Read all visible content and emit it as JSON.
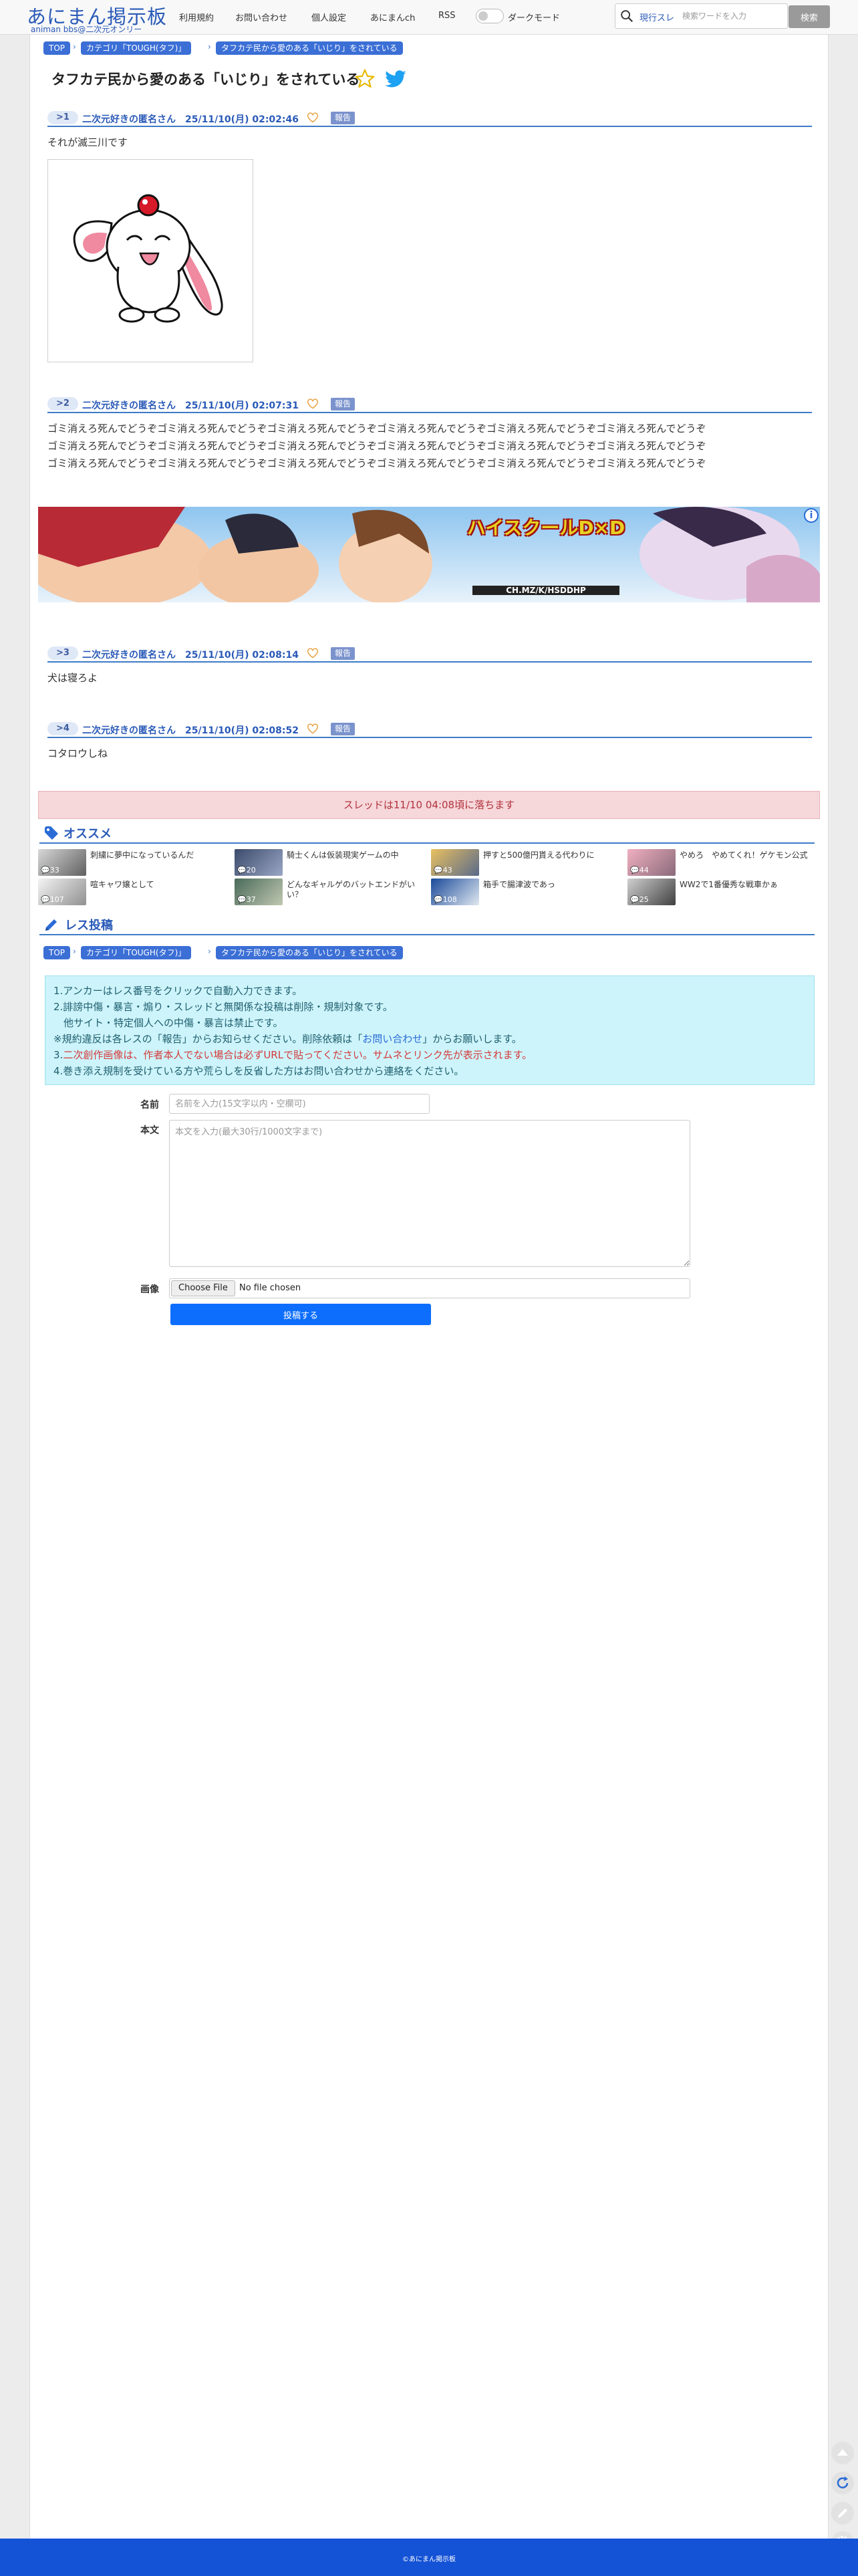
{
  "header": {
    "logo_main": "あにまん掲示板",
    "logo_sub": "animan bbs@二次元オンリー",
    "nav": [
      "利用規約",
      "お問い合わせ",
      "個人設定",
      "あにまんch",
      "RSS"
    ],
    "dark_mode_label": "ダークモード",
    "search_scope": "現行スレ",
    "search_placeholder": "検索ワードを入力",
    "search_button": "検索"
  },
  "breadcrumb": [
    "TOP",
    "カテゴリ「TOUGH(タフ)」",
    "タフカテ民から愛のある「いじり」をされている"
  ],
  "thread_title": "タフカテ民から愛のある「いじり」をされている",
  "posts": [
    {
      "no": "1",
      "meta": "二次元好きの匿名さん　25/11/10(月) 02:02:46",
      "body": [
        "それが滅三川です"
      ],
      "report": "報告"
    },
    {
      "no": "2",
      "meta": "二次元好きの匿名さん　25/11/10(月) 02:07:31",
      "body": [
        "ゴミ消えろ死んでどうぞゴミ消えろ死んでどうぞゴミ消えろ死んでどうぞゴミ消えろ死んでどうぞゴミ消えろ死んでどうぞゴミ消えろ死んでどうぞ",
        "ゴミ消えろ死んでどうぞゴミ消えろ死んでどうぞゴミ消えろ死んでどうぞゴミ消えろ死んでどうぞゴミ消えろ死んでどうぞゴミ消えろ死んでどうぞ",
        "ゴミ消えろ死んでどうぞゴミ消えろ死んでどうぞゴミ消えろ死んでどうぞゴミ消えろ死んでどうぞゴミ消えろ死んでどうぞゴミ消えろ死んでどうぞ"
      ],
      "report": "報告"
    },
    {
      "no": "3",
      "meta": "二次元好きの匿名さん　25/11/10(月) 02:08:14",
      "body": [
        "犬は寝ろよ"
      ],
      "report": "報告"
    },
    {
      "no": "4",
      "meta": "二次元好きの匿名さん　25/11/10(月) 02:08:52",
      "body": [
        "コタロウしね"
      ],
      "report": "報告"
    }
  ],
  "ad": {
    "title_text": "ハイスクールD×D",
    "sub_text": "CH.MZ/K/HSDDHP"
  },
  "notice": "スレッドは11/10 04:08頃に落ちます",
  "recommend": {
    "title": "オススメ",
    "items": [
      {
        "title": "刺繍に夢中になっているんだ",
        "count": "33"
      },
      {
        "title": "騎士くんは仮装現実ゲームの中",
        "count": "20"
      },
      {
        "title": "押すと500億円貰える代わりに",
        "count": "43"
      },
      {
        "title": "やめろ　やめてくれ！ゲケモン公式",
        "count": "44"
      },
      {
        "title": "喧キャワ嬢として",
        "count": "107"
      },
      {
        "title": "どんなギャルゲのバットエンドがいい？",
        "count": "37"
      },
      {
        "title": "箱手で腸津波であっ",
        "count": "108"
      },
      {
        "title": "WW2で1番優秀な戦車かぁ",
        "count": "25"
      }
    ]
  },
  "reply": {
    "title": "レス投稿",
    "rules": [
      "1.アンカーはレス番号をクリックで自動入力できます。",
      "2.誹謗中傷・暴言・煽り・スレッドと無関係な投稿は削除・規制対象です。",
      "　他サイト・特定個人への中傷・暴言は禁止です。",
      "※規約違反は各レスの「報告」からお知らせください。削除依頼は「",
      "お問い合わせ",
      "」からお願いします。",
      "3.",
      "二次創作画像は、作者本人でない場合は必ずURLで貼ってください。サムネとリンク先が表示されます。",
      "4.巻き添え規制を受けている方や荒らしを反省した方はお問い合わせから連絡をください。"
    ],
    "name_label": "名前",
    "name_placeholder": "名前を入力(15文字以内・空欄可)",
    "body_label": "本文",
    "body_placeholder": "本文を入力(最大30行/1000文字まで)",
    "image_label": "画像",
    "file_button": "Choose File",
    "file_status": "No file chosen",
    "submit": "投稿する"
  },
  "footer": "©あにまん掲示板",
  "colors": {
    "accent": "#2a5ab8",
    "header_line": "#3e7bc8",
    "notice_bg": "#f6d7da",
    "rules_bg": "#cdf4fb",
    "submit": "#0d6efd",
    "footer": "#1452d6"
  }
}
